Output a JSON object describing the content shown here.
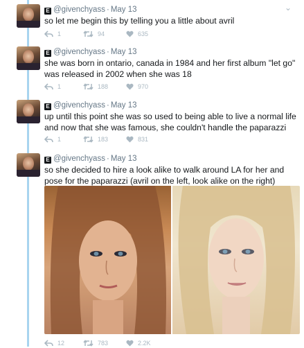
{
  "tweets": [
    {
      "user": {
        "badge": "E",
        "handle": "@givenchyass",
        "time": "May 13"
      },
      "text": "so let me begin this by telling you a little about avril",
      "stats": {
        "replies": "1",
        "retweets": "94",
        "likes": "635"
      }
    },
    {
      "user": {
        "badge": "E",
        "handle": "@givenchyass",
        "time": "May 13"
      },
      "text": "she was born in ontario, canada in 1984 and her first album \"let go\" was released in 2002 when she was 18",
      "stats": {
        "replies": "1",
        "retweets": "188",
        "likes": "970"
      }
    },
    {
      "user": {
        "badge": "E",
        "handle": "@givenchyass",
        "time": "May 13"
      },
      "text": "up until this point she was so used to being able to live a normal life and now that she was famous, she couldn't handle the paparazzi",
      "stats": {
        "replies": "1",
        "retweets": "183",
        "likes": "831"
      }
    },
    {
      "user": {
        "badge": "E",
        "handle": "@givenchyass",
        "time": "May 13"
      },
      "text": "so she decided to hire a look alike to walk around LA for her and pose for the paparazzi (avril on the left, look alike on the right)",
      "stats": {
        "replies": "12",
        "retweets": "783",
        "likes": "2.2K"
      }
    }
  ],
  "colors": {
    "thread": "#a8d4ef",
    "icon": "#aab8c2",
    "text": "#14171a",
    "meta": "#657786"
  }
}
